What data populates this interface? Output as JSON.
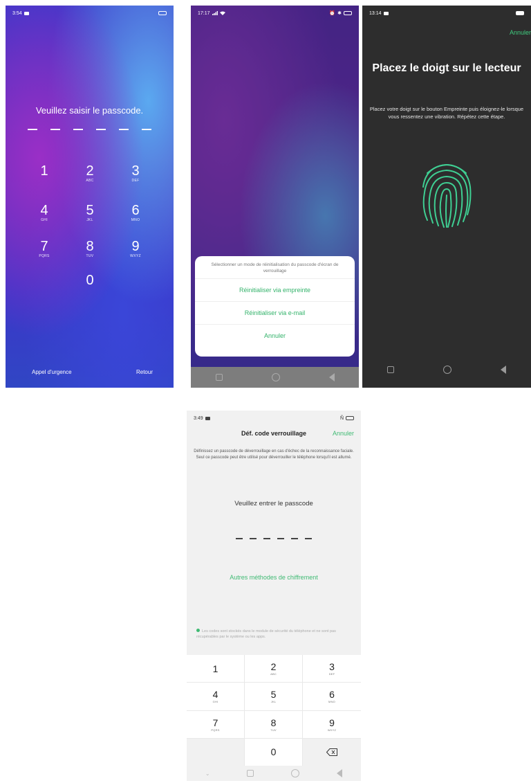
{
  "screen1": {
    "status_time": "3:54",
    "title": "Veuillez saisir le passcode.",
    "keys": [
      {
        "digit": "1",
        "letters": ""
      },
      {
        "digit": "2",
        "letters": "ABC"
      },
      {
        "digit": "3",
        "letters": "DEF"
      },
      {
        "digit": "4",
        "letters": "GHI"
      },
      {
        "digit": "5",
        "letters": "JKL"
      },
      {
        "digit": "6",
        "letters": "MNO"
      },
      {
        "digit": "7",
        "letters": "PQRS"
      },
      {
        "digit": "8",
        "letters": "TUV"
      },
      {
        "digit": "9",
        "letters": "WXYZ"
      },
      {
        "digit": "0",
        "letters": ""
      }
    ],
    "emergency": "Appel d'urgence",
    "back": "Retour"
  },
  "screen2": {
    "status_time": "17:17",
    "sheet_title": "Sélectionner un mode de réinitialisation du passcode d'écran de verrouillage",
    "option_fingerprint": "Réinitialiser via empreinte",
    "option_email": "Réinitialiser via e-mail",
    "cancel": "Annuler"
  },
  "screen3": {
    "status_time": "13:14",
    "cancel": "Annuler",
    "title": "Placez le doigt sur le lecteur",
    "description": "Placez votre doigt sur le bouton Empreinte puis éloignez-le lorsque vous ressentez une vibration. Répétez cette étape."
  },
  "screen4": {
    "status_time": "3:49",
    "title": "Déf. code verrouillage",
    "cancel": "Annuler",
    "description": "Définissez un passcode de déverrouillage en cas d'échec de la reconnaissance faciale. Seul ce passcode peut être utilisé pour déverrouiller le téléphone lorsqu'il est allumé.",
    "enter_prompt": "Veuillez entrer le passcode",
    "other_methods": "Autres méthodes de chiffrement",
    "note": "Les codes sont stockés dans le module de sécurité du téléphone et ne sont pas récupérables par le système ou les apps.",
    "keys": [
      {
        "digit": "1",
        "letters": ""
      },
      {
        "digit": "2",
        "letters": "ABC"
      },
      {
        "digit": "3",
        "letters": "DEF"
      },
      {
        "digit": "4",
        "letters": "GHI"
      },
      {
        "digit": "5",
        "letters": "JKL"
      },
      {
        "digit": "6",
        "letters": "MNO"
      },
      {
        "digit": "7",
        "letters": "PQRS"
      },
      {
        "digit": "8",
        "letters": "TUV"
      },
      {
        "digit": "9",
        "letters": "WXYZ"
      },
      {
        "digit": "0",
        "letters": ""
      }
    ]
  },
  "colors": {
    "accent_green": "#3fba73",
    "dark_bg": "#2d2d2d",
    "light_bg": "#f1f1f1"
  },
  "icons": [
    "image-icon",
    "signal-icon",
    "wifi-icon",
    "battery-icon",
    "fingerprint-icon",
    "backspace-icon",
    "home-icon",
    "recent-apps-icon",
    "back-icon",
    "chevron-down-icon",
    "nfc-icon",
    "shield-dot-icon"
  ]
}
